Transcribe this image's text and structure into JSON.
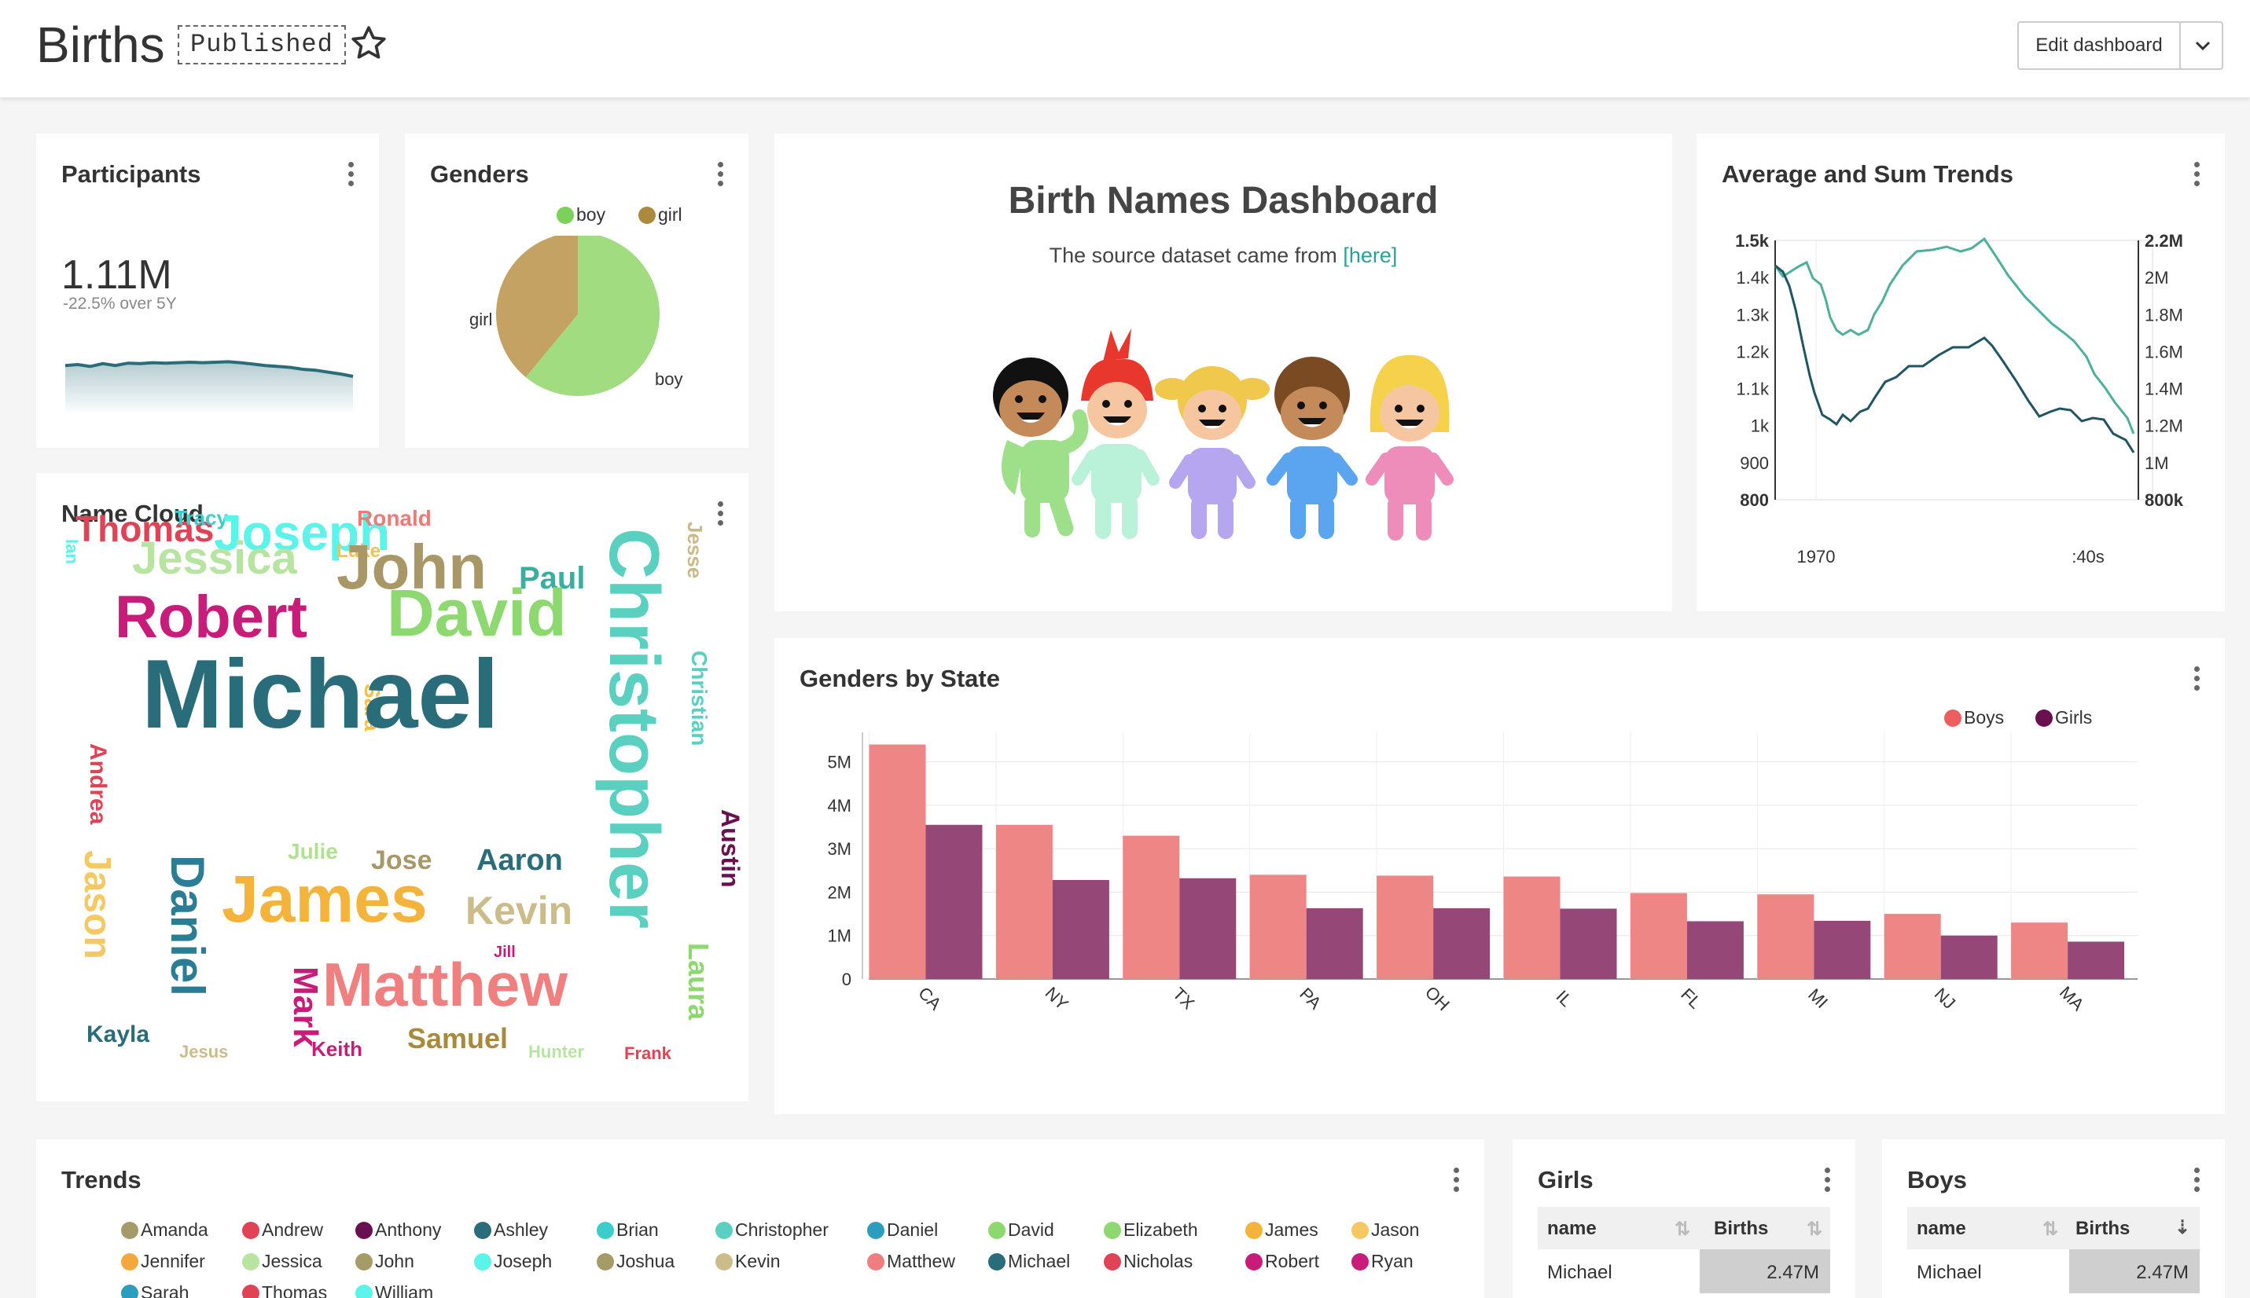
{
  "header": {
    "title": "Births",
    "status": "Published",
    "edit_label": "Edit dashboard"
  },
  "participants": {
    "title": "Participants",
    "value": "1.11M",
    "subtext": "-22.5% over 5Y",
    "sparkline": [
      0.62,
      0.6,
      0.64,
      0.58,
      0.62,
      0.57,
      0.58,
      0.56,
      0.57,
      0.56,
      0.55,
      0.56,
      0.55,
      0.54,
      0.56,
      0.59,
      0.62,
      0.64,
      0.66,
      0.7,
      0.72,
      0.76,
      0.8,
      0.85
    ]
  },
  "genders": {
    "title": "Genders",
    "legend": [
      {
        "label": "boy",
        "color": "#9fdc7c"
      },
      {
        "label": "girl",
        "color": "#c4a064"
      }
    ],
    "slices": [
      {
        "label": "boy",
        "value": 0.61,
        "color": "#a1dc80"
      },
      {
        "label": "girl",
        "value": 0.39,
        "color": "#c4a264"
      }
    ]
  },
  "markdown": {
    "title": "Birth Names Dashboard",
    "subtitle_prefix": "The source dataset came from ",
    "link_text": "[here]"
  },
  "trends_panel": {
    "title": "Average and Sum Trends",
    "left_ticks": [
      "1.5k",
      "1.4k",
      "1.3k",
      "1.2k",
      "1.1k",
      "1k",
      "900",
      "800"
    ],
    "right_ticks": [
      "2.2M",
      "2M",
      "1.8M",
      "1.6M",
      "1.4M",
      "1.2M",
      "1M",
      "800k"
    ],
    "x_ticks": [
      "1970",
      ":40s"
    ]
  },
  "name_cloud": {
    "title": "Name Cloud",
    "words": [
      {
        "text": "Thomas",
        "color": "#e04355"
      },
      {
        "text": "Tracy",
        "color": "#3cccca"
      },
      {
        "text": "Joseph",
        "color": "#5af4ea"
      },
      {
        "text": "Ronald",
        "color": "#ee7a78"
      },
      {
        "text": "Ian",
        "color": "#5af4ea"
      },
      {
        "text": "Jessica",
        "color": "#b7e4a0"
      },
      {
        "text": "Luke",
        "color": "#f0c05a"
      },
      {
        "text": "John",
        "color": "#a89868"
      },
      {
        "text": "Paul",
        "color": "#3aafa0"
      },
      {
        "text": "Jesse",
        "color": "#cbba86"
      },
      {
        "text": "Christopher",
        "color": "#5ad0c0"
      },
      {
        "text": "Christian",
        "color": "#5ad0c0"
      },
      {
        "text": "Robert",
        "color": "#c81c7a"
      },
      {
        "text": "Sara",
        "color": "#f4c04c"
      },
      {
        "text": "David",
        "color": "#8ed870"
      },
      {
        "text": "Andrea",
        "color": "#e04355"
      },
      {
        "text": "Michael",
        "color": "#2a6d7a"
      },
      {
        "text": "Austin",
        "color": "#6a0f50"
      },
      {
        "text": "Jason",
        "color": "#f4c862"
      },
      {
        "text": "Daniel",
        "color": "#2b7d96"
      },
      {
        "text": "Julie",
        "color": "#b0e090"
      },
      {
        "text": "Jose",
        "color": "#a89868"
      },
      {
        "text": "Aaron",
        "color": "#2a6d7a"
      },
      {
        "text": "James",
        "color": "#f4b43c"
      },
      {
        "text": "Kevin",
        "color": "#cbbc8a"
      },
      {
        "text": "Laura",
        "color": "#8ed870"
      },
      {
        "text": "Mark",
        "color": "#c81c7a"
      },
      {
        "text": "Jill",
        "color": "#c81c7a"
      },
      {
        "text": "Matthew",
        "color": "#f08080"
      },
      {
        "text": "Kayla",
        "color": "#2a6d7a"
      },
      {
        "text": "Jesus",
        "color": "#cbbc8a"
      },
      {
        "text": "Keith",
        "color": "#c81c7a"
      },
      {
        "text": "Samuel",
        "color": "#a88a3c"
      },
      {
        "text": "Hunter",
        "color": "#b7e4a0"
      },
      {
        "text": "Frank",
        "color": "#e04355"
      }
    ]
  },
  "genders_by_state": {
    "title": "Genders by State",
    "legend": [
      {
        "label": "Boys",
        "color": "#ef7e7e"
      },
      {
        "label": "Girls",
        "color": "#6a0f50"
      }
    ]
  },
  "chart_data": {
    "type": "bar",
    "categories": [
      "CA",
      "NY",
      "TX",
      "PA",
      "OH",
      "IL",
      "FL",
      "MI",
      "NJ",
      "MA"
    ],
    "series": [
      {
        "name": "Boys",
        "values": [
          5.4,
          3.55,
          3.3,
          2.4,
          2.38,
          2.36,
          1.98,
          1.95,
          1.5,
          1.3
        ],
        "color": "#ef8686"
      },
      {
        "name": "Girls",
        "values": [
          3.55,
          2.28,
          2.32,
          1.63,
          1.63,
          1.62,
          1.33,
          1.34,
          1.0,
          0.86
        ],
        "color": "#954878"
      }
    ],
    "y_ticks": [
      "5M",
      "4M",
      "3M",
      "2M",
      "1M",
      "0"
    ],
    "ylim": [
      0,
      5.5
    ],
    "legend_position": "top-right",
    "grid": true
  },
  "trends": {
    "title": "Trends",
    "legend": [
      {
        "label": "Amanda",
        "color": "#a49b68"
      },
      {
        "label": "Andrew",
        "color": "#e04355"
      },
      {
        "label": "Anthony",
        "color": "#6a0f50"
      },
      {
        "label": "Ashley",
        "color": "#2a6d7a"
      },
      {
        "label": "Brian",
        "color": "#3cccca"
      },
      {
        "label": "Christopher",
        "color": "#5ad0c0"
      },
      {
        "label": "Daniel",
        "color": "#2b9ebe"
      },
      {
        "label": "David",
        "color": "#8ed870"
      },
      {
        "label": "Elizabeth",
        "color": "#8ed870"
      },
      {
        "label": "James",
        "color": "#f4b43c"
      },
      {
        "label": "Jason",
        "color": "#f4c862"
      },
      {
        "label": "Jennifer",
        "color": "#f4a83c"
      },
      {
        "label": "Jessica",
        "color": "#b7e4a0"
      },
      {
        "label": "John",
        "color": "#a49b68"
      },
      {
        "label": "Joseph",
        "color": "#5af4ea"
      },
      {
        "label": "Joshua",
        "color": "#a49b68"
      },
      {
        "label": "Kevin",
        "color": "#cbbc8a"
      },
      {
        "label": "Matthew",
        "color": "#ef7e7e"
      },
      {
        "label": "Michael",
        "color": "#2a6d7a"
      },
      {
        "label": "Nicholas",
        "color": "#e04355"
      },
      {
        "label": "Robert",
        "color": "#c81c7a"
      },
      {
        "label": "Ryan",
        "color": "#c81c7a"
      },
      {
        "label": "Sarah",
        "color": "#2b9ebe"
      },
      {
        "label": "Thomas",
        "color": "#e04355"
      },
      {
        "label": "William",
        "color": "#5af4ea"
      }
    ]
  },
  "girls_table": {
    "title": "Girls",
    "columns": [
      "name",
      "Births"
    ],
    "rows": [
      {
        "name": "Michael",
        "births": "2.47M"
      }
    ]
  },
  "boys_table": {
    "title": "Boys",
    "columns": [
      "name",
      "Births"
    ],
    "rows": [
      {
        "name": "Michael",
        "births": "2.47M"
      }
    ]
  }
}
